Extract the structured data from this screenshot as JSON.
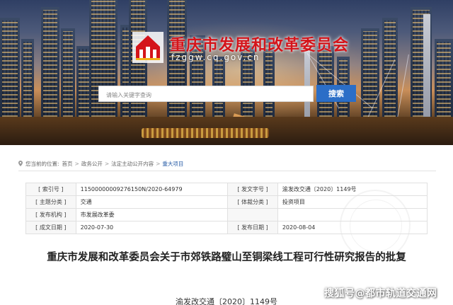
{
  "header": {
    "site_title": "重庆市发展和改革委员会",
    "site_domain": "fzggw.cq.gov.cn",
    "search_placeholder": "请输入关键字查询",
    "search_button": "搜索"
  },
  "breadcrumb": {
    "prefix": "您当前的位置:",
    "items": [
      "首页",
      "政务公开",
      "法定主动公开内容",
      "重大项目"
    ],
    "separator": ">"
  },
  "info_table": {
    "rows": [
      {
        "l1": "[ 索引号 ]",
        "v1": "11500000009276150N/2020-64979",
        "l2": "[ 发文字号 ]",
        "v2": "渝发改交通〔2020〕1149号"
      },
      {
        "l1": "[ 主题分类 ]",
        "v1": "交通",
        "l2": "[ 体裁分类 ]",
        "v2": "投资项目"
      },
      {
        "l1": "[ 发布机构 ]",
        "v1": "市发展改革委",
        "l2": "",
        "v2": ""
      },
      {
        "l1": "[ 成文日期 ]",
        "v1": "2020-07-30",
        "l2": "[ 发布日期 ]",
        "v2": "2020-08-04"
      }
    ]
  },
  "document": {
    "title": "重庆市发展和改革委员会关于市郊铁路璧山至铜梁线工程可行性研究报告的批复",
    "number": "渝发改交通〔2020〕1149号"
  },
  "watermark": {
    "text": "搜狐号@都市轨道交通网"
  },
  "colors": {
    "title_red": "#d4141a",
    "search_blue": "#2b6ec7",
    "breadcrumb_current": "#2b5fa8"
  }
}
